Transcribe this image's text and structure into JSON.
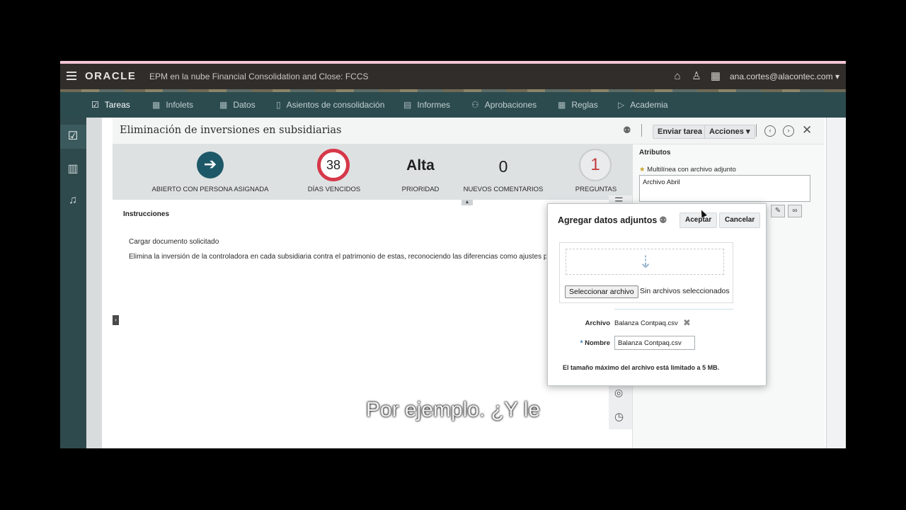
{
  "topbar": {
    "logo": "ORACLE",
    "app_title": "EPM en la nube Financial Consolidation and Close:  FCCS",
    "user": "ana.cortes@alacontec.com"
  },
  "nav": {
    "items": [
      {
        "label": "Tareas",
        "icon": "clipboard-icon",
        "active": true
      },
      {
        "label": "Infolets",
        "icon": "grid-icon",
        "active": false
      },
      {
        "label": "Datos",
        "icon": "grid-icon",
        "active": false
      },
      {
        "label": "Asientos de consolidación",
        "icon": "book-icon",
        "active": false
      },
      {
        "label": "Informes",
        "icon": "report-icon",
        "active": false
      },
      {
        "label": "Aprobaciones",
        "icon": "people-icon",
        "active": false
      },
      {
        "label": "Reglas",
        "icon": "grid-icon",
        "active": false
      },
      {
        "label": "Academia",
        "icon": "play-icon",
        "active": false
      }
    ]
  },
  "task": {
    "title": "Eliminación de inversiones en subsidiarias",
    "send_label": "Enviar tarea",
    "actions_label": "Acciones",
    "stats": [
      {
        "value": "",
        "label": "ABIERTO CON PERSONA ASIGNADA"
      },
      {
        "value": "38",
        "label": "DÍAS VENCIDOS"
      },
      {
        "value": "Alta",
        "label": "PRIORIDAD"
      },
      {
        "value": "0",
        "label": "NUEVOS COMENTARIOS"
      },
      {
        "value": "1",
        "label": "PREGUNTAS"
      }
    ],
    "instructions_label": "Instrucciones",
    "instruction_line1": "Cargar documento solicitado",
    "instruction_line2": "Elimina la inversión de la controladora en cada subsidiaria contra el patrimonio de estas, reconociendo las diferencias como ajustes por"
  },
  "attributes": {
    "title": "Atributos",
    "field_label": "Multilínea con archivo adjunto",
    "field_value": "Archivo Abril"
  },
  "dialog": {
    "title": "Agregar datos adjuntos",
    "accept_label": "Aceptar",
    "cancel_label": "Cancelar",
    "choose_file_label": "Seleccionar archivo",
    "no_file_text": "Sin archivos seleccionados",
    "file_label": "Archivo",
    "file_value": "Balanza Contpaq.csv",
    "name_label": "Nombre",
    "name_value": "Balanza Contpaq.csv",
    "limit_text": "El tamaño máximo del archivo está limitado a 5 MB."
  },
  "subtitle": "Por ejemplo. ¿Y le",
  "colors": {
    "topbar": "#312d2a",
    "navbar": "#2c4b4f",
    "accent_teal": "#1d5868",
    "overdue_red": "#d6384a"
  }
}
